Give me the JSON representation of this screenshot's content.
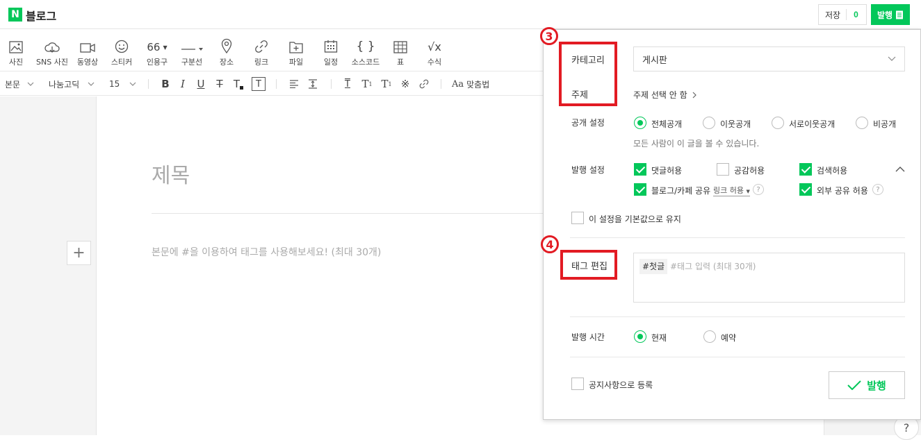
{
  "app": {
    "logo_letter": "N",
    "title": "블로그"
  },
  "header": {
    "save_label": "저장",
    "save_count": "0",
    "publish_label": "발행"
  },
  "toolbar": {
    "items": [
      {
        "label": "사진",
        "icon": "image-icon"
      },
      {
        "label": "SNS 사진",
        "icon": "cloud-icon"
      },
      {
        "label": "동영상",
        "icon": "video-icon"
      },
      {
        "label": "스티커",
        "icon": "smile-icon"
      },
      {
        "label": "인용구",
        "icon": "quote-icon",
        "glyph": "66"
      },
      {
        "label": "구분선",
        "icon": "divider-icon"
      },
      {
        "label": "장소",
        "icon": "location-pin-icon"
      },
      {
        "label": "링크",
        "icon": "link-icon"
      },
      {
        "label": "파일",
        "icon": "folder-plus-icon"
      },
      {
        "label": "일정",
        "icon": "calendar-icon"
      },
      {
        "label": "소스코드",
        "icon": "code-braces-icon",
        "glyph": "{ }"
      },
      {
        "label": "표",
        "icon": "table-icon"
      },
      {
        "label": "수식",
        "icon": "formula-icon",
        "glyph": "√x"
      }
    ]
  },
  "format_bar": {
    "paragraph": "본문",
    "font": "나눔고딕",
    "size": "15",
    "buttons": [
      "B",
      "I",
      "U",
      "T",
      "T",
      "T"
    ],
    "spellcheck": "맞춤법"
  },
  "editor": {
    "title_placeholder": "제목",
    "body_placeholder": "본문에 #을 이용하여 태그를 사용해보세요! (최대 30개)"
  },
  "panel": {
    "category_label": "카테고리",
    "category_value": "게시판",
    "topic_label": "주제",
    "topic_value": "주제 선택 안 함",
    "visibility_label": "공개 설정",
    "visibility_options": [
      "전체공개",
      "이웃공개",
      "서로이웃공개",
      "비공개"
    ],
    "visibility_selected": 0,
    "visibility_note": "모든 사람이 이 글을 볼 수 있습니다.",
    "publish_settings_label": "발행 설정",
    "opt_comments": "댓글허용",
    "opt_empathy": "공감허용",
    "opt_search": "검색허용",
    "opt_share": "블로그/카페 공유",
    "opt_link": "링크 허용",
    "opt_external": "외부 공유 허용",
    "keep_default": "이 설정을 기본값으로 유지",
    "tag_label": "태그 편집",
    "tag_chip": "#첫글",
    "tag_placeholder": "#태그 입력 (최대 30개)",
    "time_label": "발행 시간",
    "time_now": "현재",
    "time_reserve": "예약",
    "notice": "공지사항으로 등록",
    "publish_button": "발행"
  },
  "annotations": {
    "step3": "3",
    "step4": "4",
    "color": "#e21b23"
  },
  "colors": {
    "accent": "#03c75a"
  },
  "help": "?"
}
